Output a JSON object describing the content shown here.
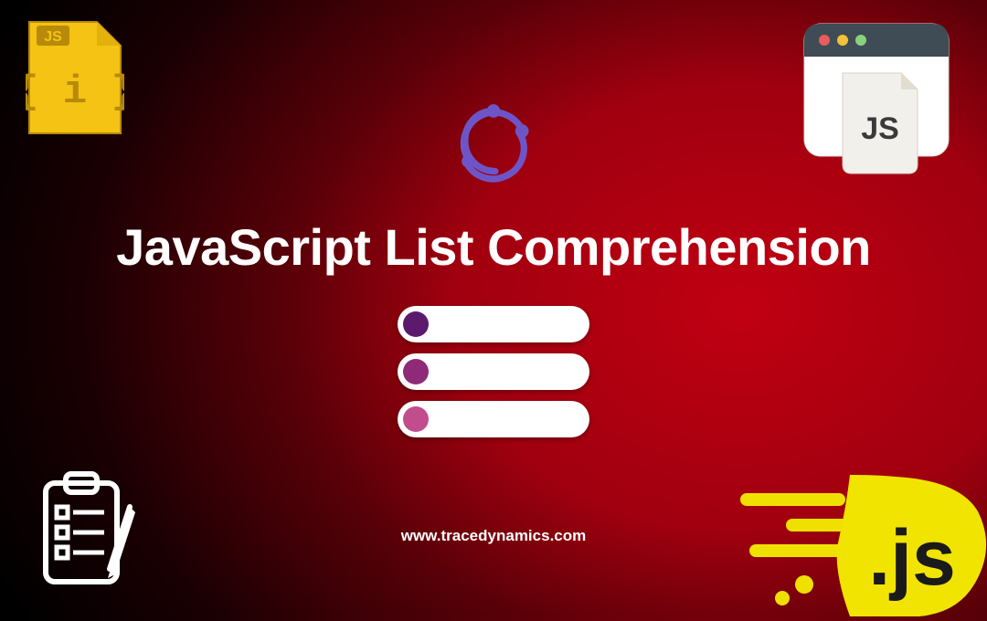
{
  "heading": "JavaScript List Comprehension",
  "url": "www.tracedynamics.com",
  "jsFile": {
    "label": "JS",
    "code": "{ i }"
  },
  "browserPaper": {
    "label": "JS"
  },
  "jsLogo": {
    "label": ".js"
  },
  "icons": {
    "jsFile": "js-file-icon",
    "browser": "browser-window-icon",
    "redux": "redux-loop-icon",
    "listBars": "list-bars-icon",
    "clipboard": "clipboard-checklist-icon",
    "jsLogo": "js-dot-logo"
  },
  "listBars": {
    "count": 3,
    "dotColors": [
      "#5b1a6b",
      "#8f2a78",
      "#c24d8c"
    ]
  }
}
